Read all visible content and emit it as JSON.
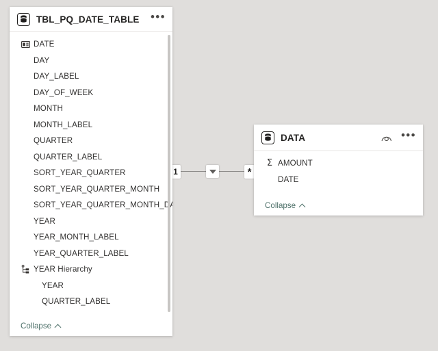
{
  "canvas": {
    "background_color": "#e0dedc"
  },
  "tables": [
    {
      "id": "tbl-pq-date-table",
      "name": "TBL_PQ_DATE_TABLE",
      "icon": "table-database-icon",
      "menu_label": "•••",
      "collapse_label": "Collapse",
      "has_hide_toggle": false,
      "fields": [
        {
          "label": "DATE",
          "icon": "date-table-marker-icon",
          "indent": 0
        },
        {
          "label": "DAY",
          "icon": "none",
          "indent": 1
        },
        {
          "label": "DAY_LABEL",
          "icon": "none",
          "indent": 1
        },
        {
          "label": "DAY_OF_WEEK",
          "icon": "none",
          "indent": 1
        },
        {
          "label": "MONTH",
          "icon": "none",
          "indent": 1
        },
        {
          "label": "MONTH_LABEL",
          "icon": "none",
          "indent": 1
        },
        {
          "label": "QUARTER",
          "icon": "none",
          "indent": 1
        },
        {
          "label": "QUARTER_LABEL",
          "icon": "none",
          "indent": 1
        },
        {
          "label": "SORT_YEAR_QUARTER",
          "icon": "none",
          "indent": 1
        },
        {
          "label": "SORT_YEAR_QUARTER_MONTH",
          "icon": "none",
          "indent": 1
        },
        {
          "label": "SORT_YEAR_QUARTER_MONTH_DAY",
          "icon": "none",
          "indent": 1
        },
        {
          "label": "YEAR",
          "icon": "none",
          "indent": 1
        },
        {
          "label": "YEAR_MONTH_LABEL",
          "icon": "none",
          "indent": 1
        },
        {
          "label": "YEAR_QUARTER_LABEL",
          "icon": "none",
          "indent": 1
        },
        {
          "label": "YEAR Hierarchy",
          "icon": "hierarchy-icon",
          "indent": 0
        },
        {
          "label": "YEAR",
          "icon": "none",
          "indent": 2
        },
        {
          "label": "QUARTER_LABEL",
          "icon": "none",
          "indent": 2
        }
      ]
    },
    {
      "id": "data-table",
      "name": "DATA",
      "icon": "table-database-icon",
      "menu_label": "•••",
      "collapse_label": "Collapse",
      "has_hide_toggle": true,
      "hide_toggle_name": "eye-icon",
      "fields": [
        {
          "label": "AMOUNT",
          "icon": "sigma-icon",
          "indent": 0
        },
        {
          "label": "DATE",
          "icon": "none",
          "indent": 1
        }
      ]
    }
  ],
  "relationship": {
    "from_cardinality": "1",
    "to_cardinality": "*",
    "cross_filter_direction": "single-down",
    "line_color": "#8a8886"
  }
}
